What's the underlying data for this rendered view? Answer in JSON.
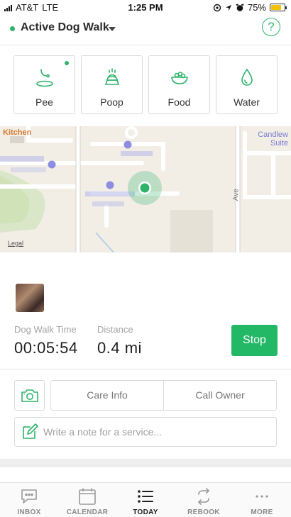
{
  "status_bar": {
    "carrier": "AT&T",
    "network": "LTE",
    "time": "1:25 PM",
    "battery": "75%",
    "battery_level": 0.75
  },
  "header": {
    "title": "Active Dog Walk",
    "help_icon": "question-circle-icon",
    "help_symbol": "?"
  },
  "services": [
    {
      "label": "Pee",
      "icon": "pee-icon",
      "active": true
    },
    {
      "label": "Poop",
      "icon": "poop-icon",
      "active": false
    },
    {
      "label": "Food",
      "icon": "food-bowl-icon",
      "active": false
    },
    {
      "label": "Water",
      "icon": "water-drop-icon",
      "active": false
    }
  ],
  "map": {
    "kitchen_label": "Kitchen",
    "suite_label_line1": "Candlew",
    "suite_label_line2": "Suite",
    "legal_label": "Legal",
    "ave_label": "Ave"
  },
  "walk": {
    "time_label": "Dog Walk Time",
    "time_value": "00:05:54",
    "distance_label": "Distance",
    "distance_value": "0.4 mi",
    "stop_label": "Stop"
  },
  "actions": {
    "camera_icon": "camera-icon",
    "care_info_label": "Care Info",
    "call_owner_label": "Call Owner",
    "note_placeholder": "Write a note for a service..."
  },
  "tabs": [
    {
      "label": "INBOX",
      "icon": "chat-bubble-icon",
      "active": false
    },
    {
      "label": "CALENDAR",
      "icon": "calendar-icon",
      "active": false
    },
    {
      "label": "TODAY",
      "icon": "list-icon",
      "active": true
    },
    {
      "label": "REBOOK",
      "icon": "rebook-icon",
      "active": false
    },
    {
      "label": "MORE",
      "icon": "more-dots-icon",
      "active": false
    }
  ],
  "colors": {
    "accent_green": "#22b865",
    "battery_yellow": "#f2c200",
    "location_green": "#2fb36b"
  }
}
